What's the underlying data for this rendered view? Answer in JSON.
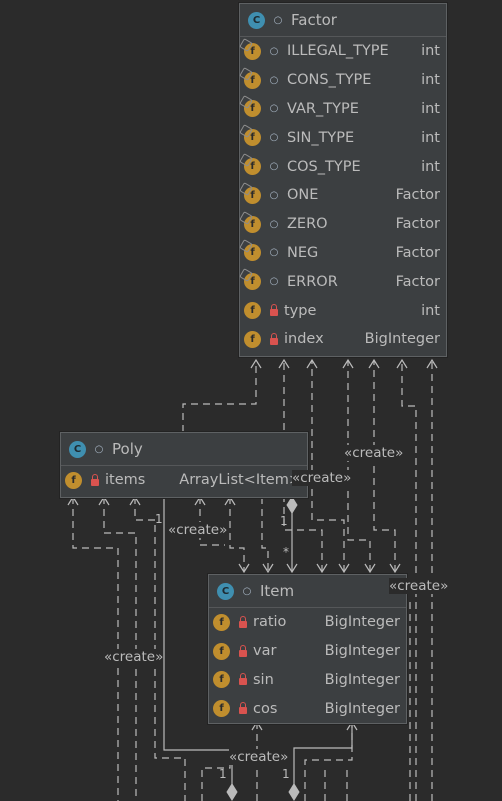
{
  "classes": {
    "factor": {
      "icon": "C",
      "name": "Factor",
      "fields": [
        {
          "icon": "f",
          "static": true,
          "visibility": "package-dot",
          "name": "ILLEGAL_TYPE",
          "type": "int"
        },
        {
          "icon": "f",
          "static": true,
          "visibility": "package-dot",
          "name": "CONS_TYPE",
          "type": "int"
        },
        {
          "icon": "f",
          "static": true,
          "visibility": "package-dot",
          "name": "VAR_TYPE",
          "type": "int"
        },
        {
          "icon": "f",
          "static": true,
          "visibility": "package-dot",
          "name": "SIN_TYPE",
          "type": "int"
        },
        {
          "icon": "f",
          "static": true,
          "visibility": "package-dot",
          "name": "COS_TYPE",
          "type": "int"
        },
        {
          "icon": "f",
          "static": true,
          "visibility": "package-dot",
          "name": "ONE",
          "type": "Factor"
        },
        {
          "icon": "f",
          "static": true,
          "visibility": "package-dot",
          "name": "ZERO",
          "type": "Factor"
        },
        {
          "icon": "f",
          "static": true,
          "visibility": "package-dot",
          "name": "NEG",
          "type": "Factor"
        },
        {
          "icon": "f",
          "static": true,
          "visibility": "package-dot",
          "name": "ERROR",
          "type": "Factor"
        },
        {
          "icon": "f",
          "static": false,
          "visibility": "private-lock",
          "name": "type",
          "type": "int"
        },
        {
          "icon": "f",
          "static": false,
          "visibility": "private-lock",
          "name": "index",
          "type": "BigInteger"
        }
      ]
    },
    "poly": {
      "icon": "C",
      "name": "Poly",
      "fields": [
        {
          "icon": "f",
          "static": false,
          "visibility": "private-lock",
          "name": "items",
          "type": "ArrayList<Item>"
        }
      ]
    },
    "item": {
      "icon": "C",
      "name": "Item",
      "fields": [
        {
          "icon": "f",
          "static": false,
          "visibility": "private-lock",
          "name": "ratio",
          "type": "BigInteger"
        },
        {
          "icon": "f",
          "static": false,
          "visibility": "private-lock",
          "name": "var",
          "type": "BigInteger"
        },
        {
          "icon": "f",
          "static": false,
          "visibility": "private-lock",
          "name": "sin",
          "type": "BigInteger"
        },
        {
          "icon": "f",
          "static": false,
          "visibility": "private-lock",
          "name": "cos",
          "type": "BigInteger"
        }
      ]
    }
  },
  "labels": {
    "create": "«create»",
    "create_clipped": "«create»",
    "mult_one": "1",
    "mult_many": "*"
  },
  "colors": {
    "background": "#2b2b2b",
    "class_fill": "#3c3f41",
    "class_icon": "#3f8fb0",
    "field_icon": "#c08e2e",
    "lock": "#d9534f",
    "connector": "#bbbbbb"
  }
}
